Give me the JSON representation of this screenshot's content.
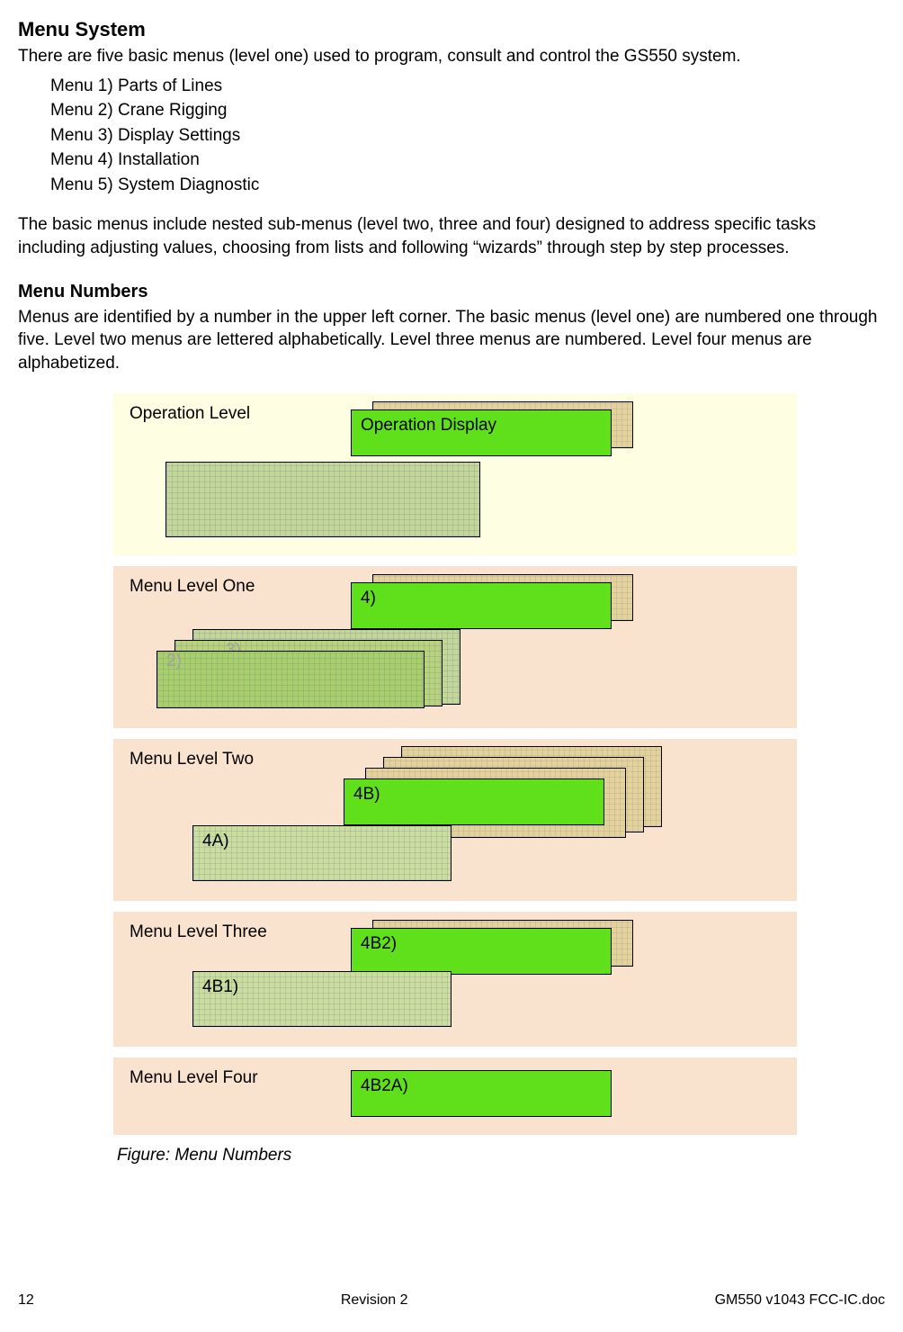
{
  "heading_main": "Menu System",
  "para_intro": "There are five basic menus (level one) used to program, consult and control the GS550 system.",
  "menu_items": [
    "Menu 1) Parts of Lines",
    "Menu 2) Crane Rigging",
    "Menu 3) Display Settings",
    "Menu 4) Installation",
    "Menu 5) System Diagnostic"
  ],
  "para_after_list": "The basic menus include nested sub-menus (level two, three and four) designed to address specific tasks including adjusting values, choosing from lists and following “wizards” through step by step processes.",
  "heading_numbers": "Menu Numbers",
  "para_numbers": "Menus are identified by a number in the upper left corner. The basic menus (level one) are numbered one through five. Level two menus are lettered alphabetically. Level three menus are numbered. Level four menus are alphabetized.",
  "figure": {
    "operation_level": "Operation Level",
    "operation_display": "Operation Display",
    "menu_level_one": "Menu Level One",
    "l1_a": "2)",
    "l1_b": "3)",
    "l1_c": "4)",
    "menu_level_two": "Menu Level Two",
    "l2_a": "4A)",
    "l2_b": "4B)",
    "menu_level_three": "Menu Level Three",
    "l3_a": "4B1)",
    "l3_b": "4B2)",
    "menu_level_four": "Menu Level Four",
    "l4_a": "4B2A)",
    "caption": "Figure: Menu Numbers"
  },
  "footer": {
    "page": "12",
    "rev": "Revision 2",
    "doc": "GM550 v1043 FCC-IC.doc"
  }
}
